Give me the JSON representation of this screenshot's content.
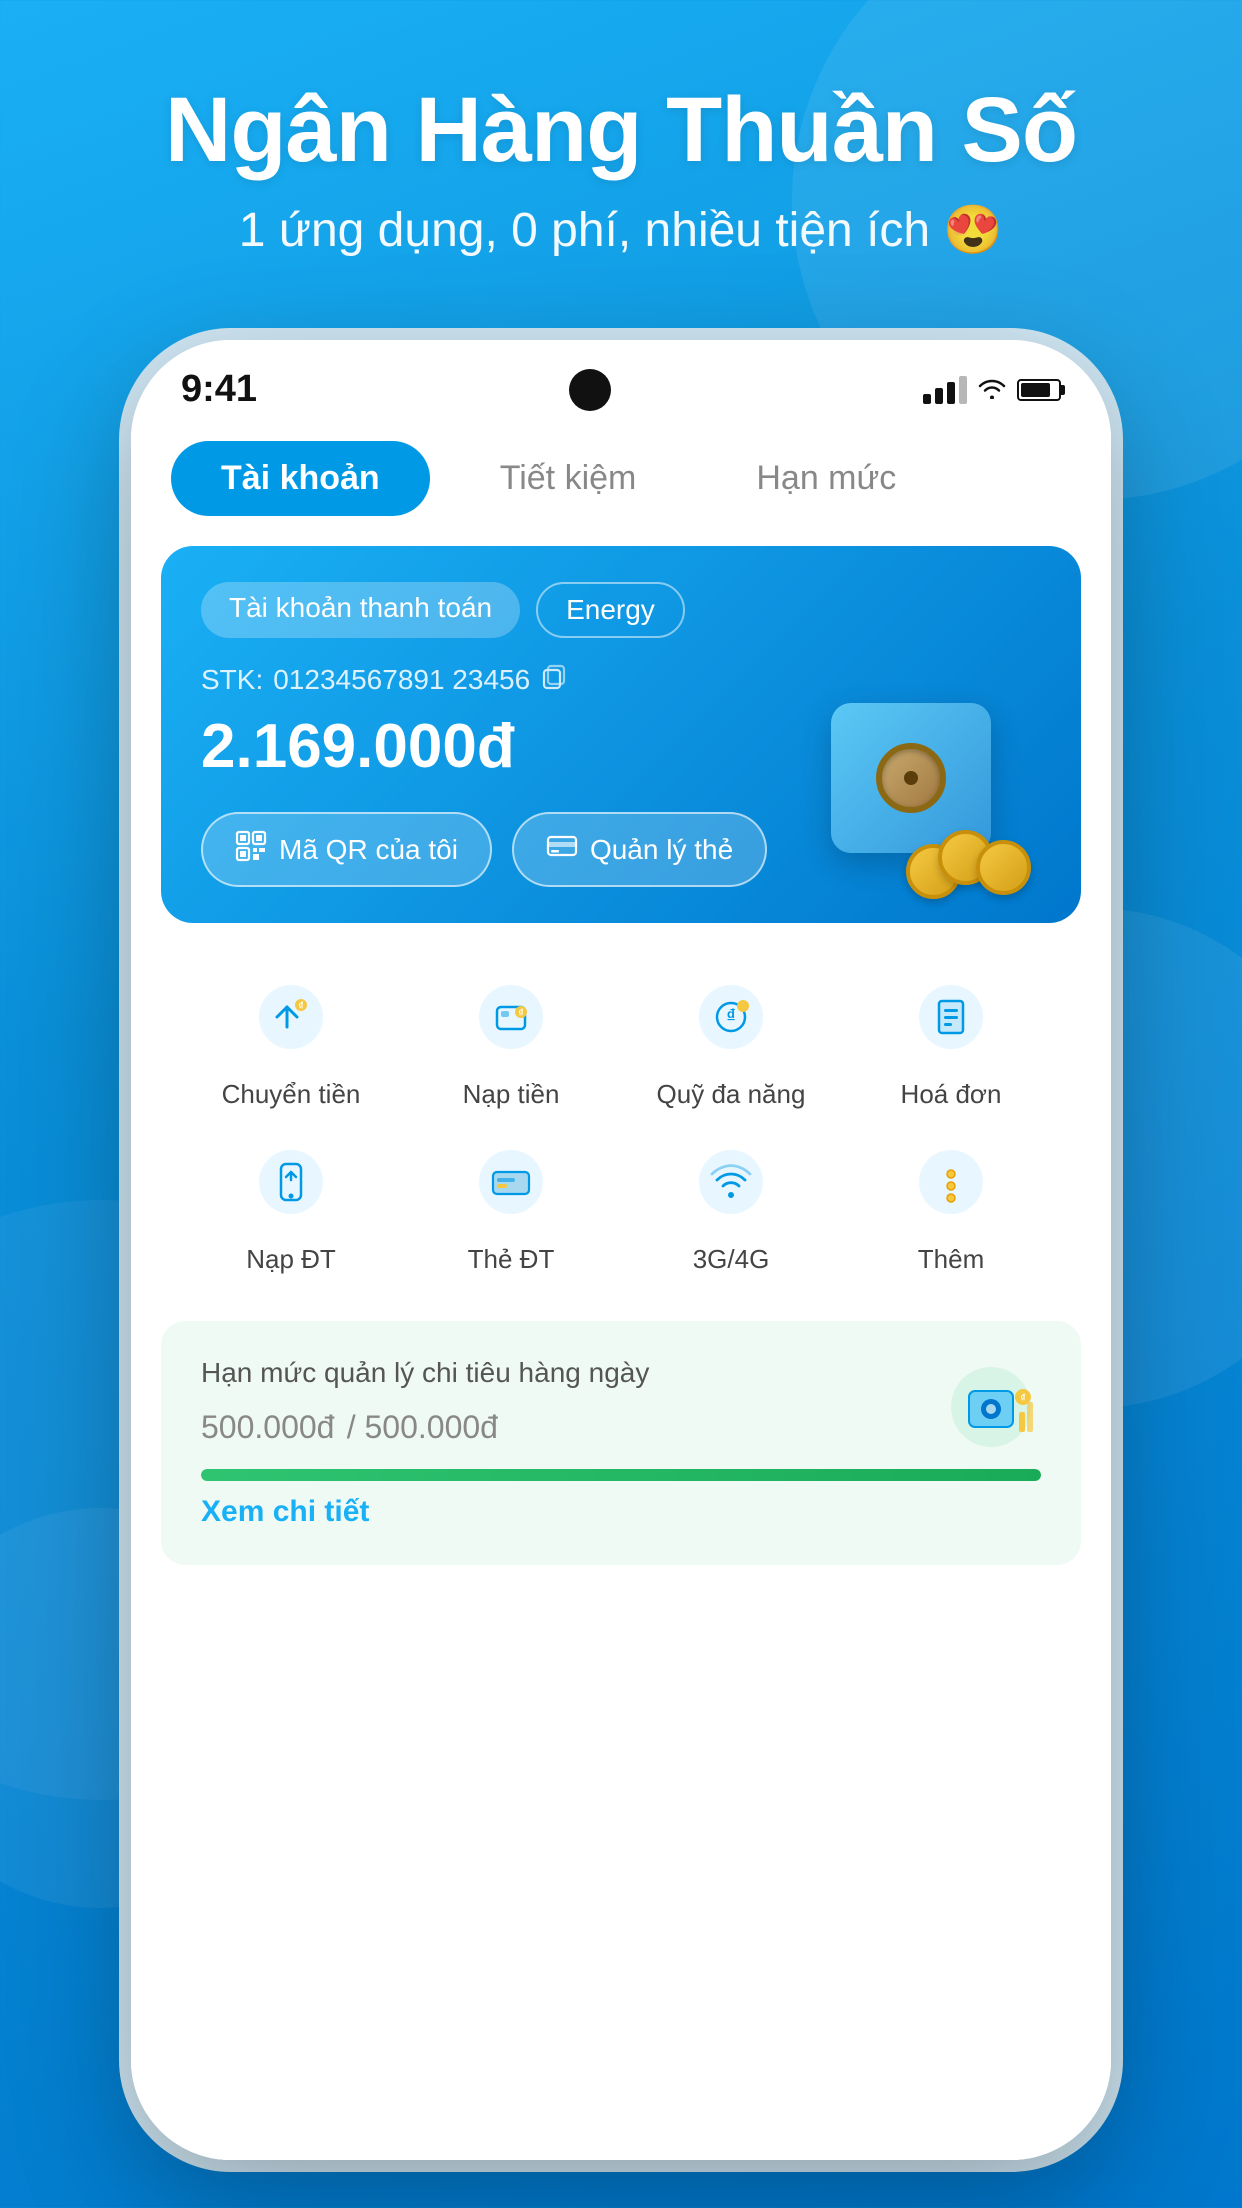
{
  "header": {
    "title": "Ngân Hàng Thuần Số",
    "subtitle": "1 ứng dụng, 0 phí, nhiều tiện ích 😍"
  },
  "statusBar": {
    "time": "9:41",
    "battery": "80"
  },
  "tabs": [
    {
      "id": "tai-khoan",
      "label": "Tài khoản",
      "active": true
    },
    {
      "id": "tiet-kiem",
      "label": "Tiết kiệm",
      "active": false
    },
    {
      "id": "han-muc",
      "label": "Hạn mức",
      "active": false
    }
  ],
  "accountCard": {
    "badge1": "Tài khoản thanh toán",
    "badge2": "Energy",
    "stkLabel": "STK:",
    "stkValue": "01234567891 23456",
    "balance": "2.169.000đ",
    "btn1Icon": "qr-icon",
    "btn1Label": "Mã QR của tôi",
    "btn2Icon": "card-icon",
    "btn2Label": "Quản lý thẻ"
  },
  "quickActions": {
    "rows": [
      [
        {
          "id": "chuyen-tien",
          "icon": "send-money-icon",
          "label": "Chuyển tiền",
          "iconColor": "#0099e6"
        },
        {
          "id": "nap-tien",
          "icon": "top-up-icon",
          "label": "Nạp tiền",
          "iconColor": "#0099e6"
        },
        {
          "id": "quy-da-nang",
          "icon": "fund-icon",
          "label": "Quỹ đa năng",
          "iconColor": "#0099e6"
        },
        {
          "id": "hoa-don",
          "icon": "bill-icon",
          "label": "Hoá đơn",
          "iconColor": "#0099e6"
        }
      ],
      [
        {
          "id": "nap-dt",
          "icon": "phone-top-icon",
          "label": "Nạp ĐT",
          "iconColor": "#0099e6"
        },
        {
          "id": "the-dt",
          "icon": "phone-card-icon",
          "label": "Thẻ ĐT",
          "iconColor": "#0099e6"
        },
        {
          "id": "3g4g",
          "icon": "wifi-data-icon",
          "label": "3G/4G",
          "iconColor": "#0099e6"
        },
        {
          "id": "them",
          "icon": "more-icon",
          "label": "Thêm",
          "iconColor": "#0099e6"
        }
      ]
    ]
  },
  "budgetCard": {
    "title": "Hạn mức quản lý chi tiêu hàng ngày",
    "amount": "500.000đ",
    "totalAmount": "/ 500.000đ",
    "progressPercent": 100,
    "ctaLabel": "Xem chi tiết"
  }
}
